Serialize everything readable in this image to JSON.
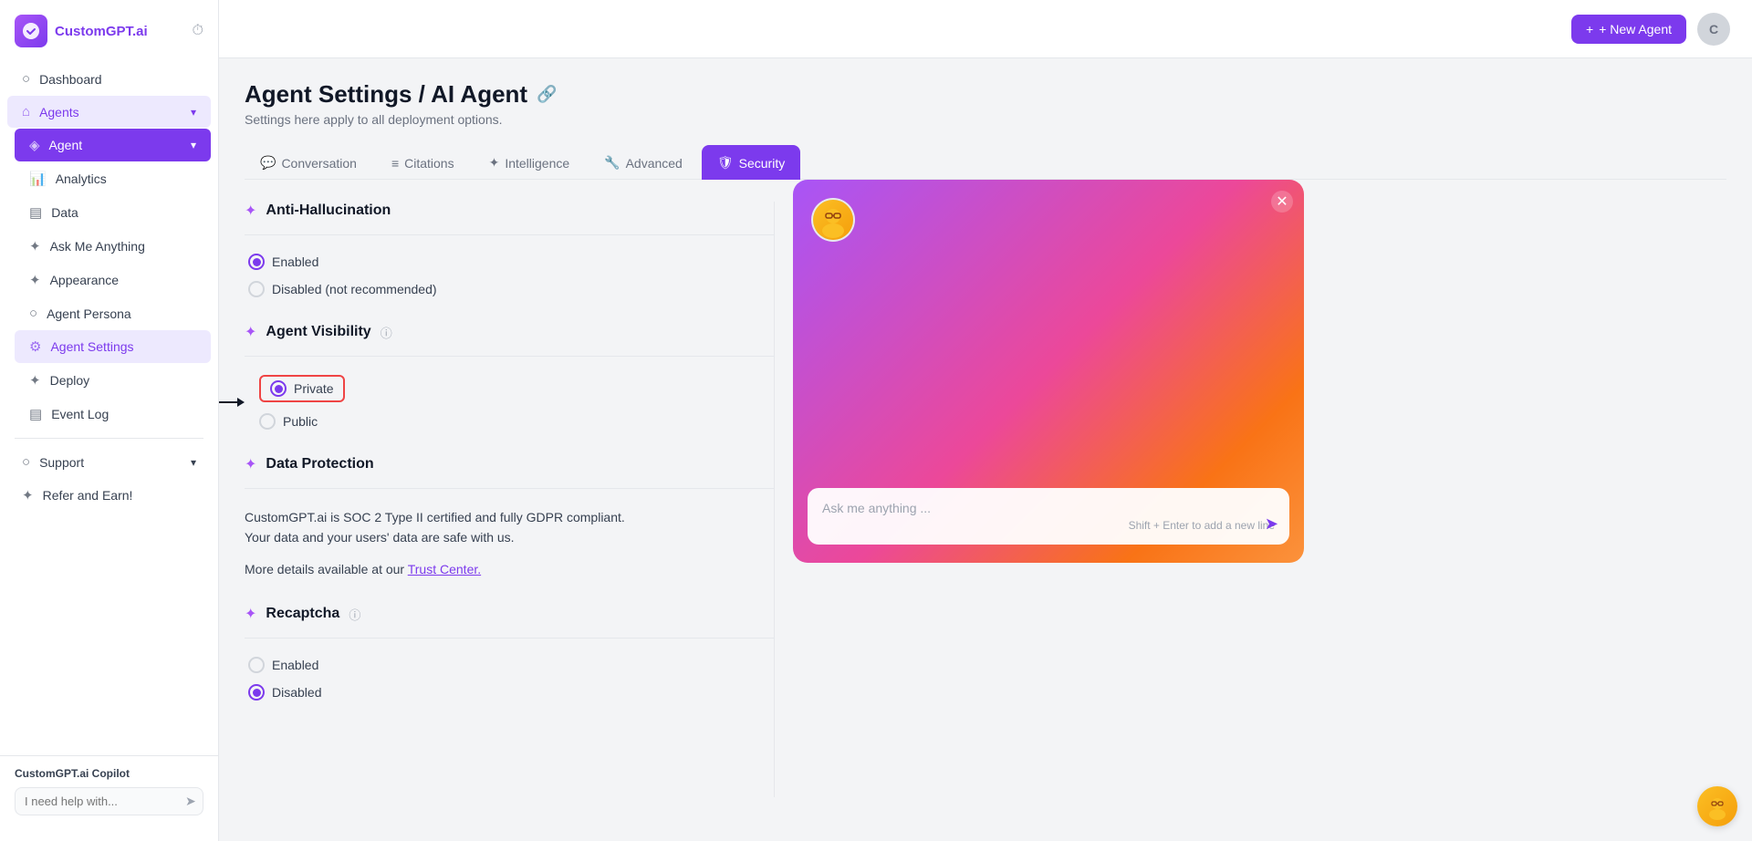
{
  "app": {
    "name": "CustomGPT.ai"
  },
  "sidebar": {
    "logo_text": "CustomGPT.ai",
    "nav_items": [
      {
        "id": "dashboard",
        "label": "Dashboard",
        "icon": "○"
      },
      {
        "id": "agents",
        "label": "Agents",
        "icon": "⌂",
        "has_chevron": true
      },
      {
        "id": "agent",
        "label": "Agent",
        "icon": "◈",
        "active": true,
        "has_chevron": true
      },
      {
        "id": "analytics",
        "label": "Analytics",
        "icon": "📊"
      },
      {
        "id": "data",
        "label": "Data",
        "icon": "▤"
      },
      {
        "id": "ask-me-anything",
        "label": "Ask Me Anything",
        "icon": "✦"
      },
      {
        "id": "appearance",
        "label": "Appearance",
        "icon": "✦"
      },
      {
        "id": "agent-persona",
        "label": "Agent Persona",
        "icon": "○"
      },
      {
        "id": "agent-settings",
        "label": "Agent Settings",
        "icon": "⚙",
        "active_sub": true
      },
      {
        "id": "deploy",
        "label": "Deploy",
        "icon": "✦"
      },
      {
        "id": "event-log",
        "label": "Event Log",
        "icon": "▤"
      },
      {
        "id": "support",
        "label": "Support",
        "icon": "○",
        "has_chevron": true
      },
      {
        "id": "refer-earn",
        "label": "Refer and Earn!",
        "icon": "✦"
      }
    ],
    "copilot_label": "CustomGPT.ai Copilot",
    "copilot_placeholder": "I need help with..."
  },
  "topbar": {
    "new_agent_label": "+ New Agent",
    "avatar_letter": "C"
  },
  "page": {
    "title": "Agent Settings / AI Agent",
    "subtitle": "Settings here apply to all deployment options."
  },
  "tabs": [
    {
      "id": "conversation",
      "label": "Conversation",
      "icon": "💬",
      "active": false
    },
    {
      "id": "citations",
      "label": "Citations",
      "icon": "≡",
      "active": false
    },
    {
      "id": "intelligence",
      "label": "Intelligence",
      "icon": "✦",
      "active": false
    },
    {
      "id": "advanced",
      "label": "Advanced",
      "icon": "🔧",
      "active": false
    },
    {
      "id": "security",
      "label": "Security",
      "icon": "🛡",
      "active": true
    }
  ],
  "sections": {
    "anti_hallucination": {
      "title": "Anti-Hallucination",
      "options": [
        {
          "label": "Enabled",
          "checked": true
        },
        {
          "label": "Disabled (not recommended)",
          "checked": false
        }
      ]
    },
    "agent_visibility": {
      "title": "Agent Visibility",
      "has_info": true,
      "options": [
        {
          "label": "Private",
          "checked": true,
          "highlighted": true
        },
        {
          "label": "Public",
          "checked": false
        }
      ]
    },
    "data_protection": {
      "title": "Data Protection",
      "description": "CustomGPT.ai is SOC 2 Type II certified and fully GDPR compliant.\nYour data and your users' data are safe with us.",
      "link_text": "Trust Center.",
      "link_prefix": "More details available at our "
    },
    "recaptcha": {
      "title": "Recaptcha",
      "has_info": true,
      "options": [
        {
          "label": "Enabled",
          "checked": false
        },
        {
          "label": "Disabled",
          "checked": true
        }
      ]
    }
  },
  "preview": {
    "chat_placeholder": "Ask me anything ...",
    "chat_hint": "Shift + Enter to add a new line"
  }
}
